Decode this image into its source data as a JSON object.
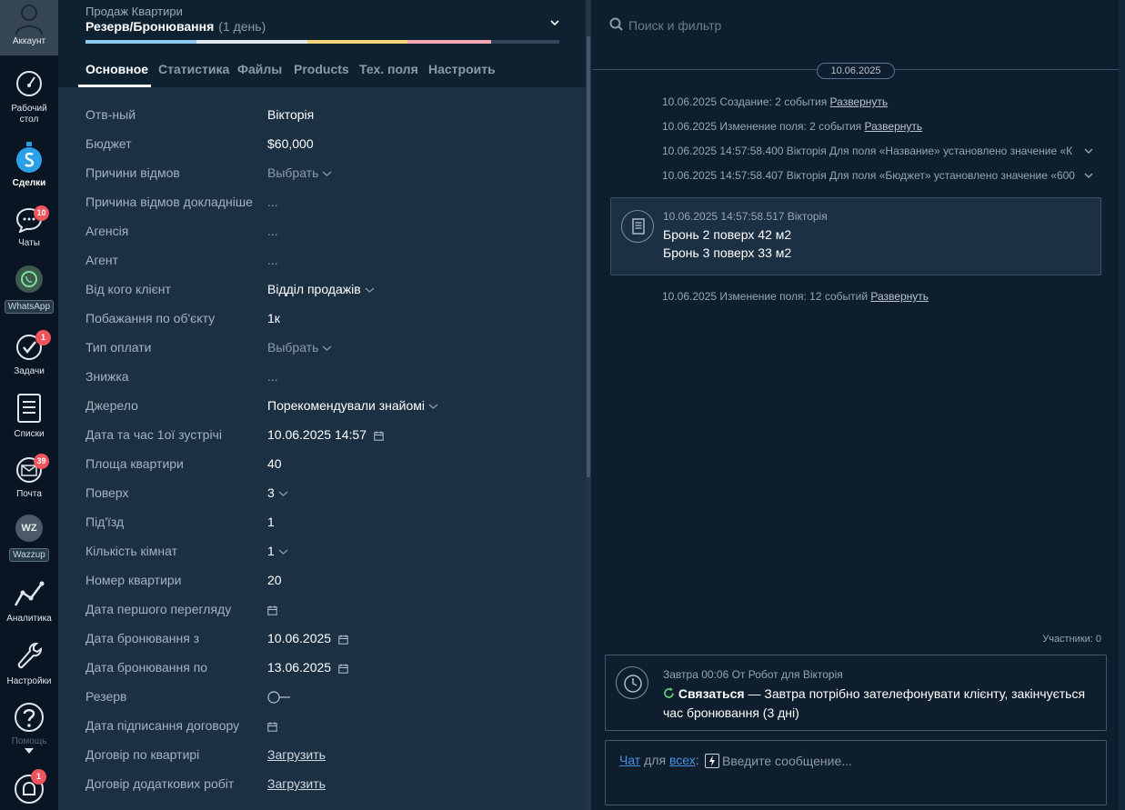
{
  "nav": {
    "account_label": "Аккаунт",
    "items": [
      {
        "label": "Рабочий стол",
        "label2": "стол"
      },
      {
        "label": "Сделки"
      },
      {
        "label": "Чаты",
        "badge": "10"
      },
      {
        "label": "WhatsApp"
      },
      {
        "label": "Задачи",
        "badge": "1"
      },
      {
        "label": "Списки"
      },
      {
        "label": "Почта",
        "badge": "39"
      },
      {
        "label": "Wazzup",
        "icon_text": "WZ"
      },
      {
        "label": "Аналитика"
      },
      {
        "label": "Настройки"
      },
      {
        "label": "Помощь"
      },
      {
        "label": "",
        "badge": "1"
      }
    ],
    "dashboard_line1": "Рабочий",
    "dashboard_line2": "стол"
  },
  "card": {
    "pipeline": "Продаж Квартири",
    "stage": "Резерв/Бронювання",
    "stage_days": "(1 день)",
    "progress_colors": [
      "#8ec9f2",
      "#f2d479",
      "#f7a7b4"
    ],
    "tabs": [
      "Основное",
      "Статистика",
      "Файлы",
      "Products",
      "Тех. поля",
      "Настроить"
    ],
    "fields": [
      {
        "label": "Отв-ный",
        "value": "Вікторія"
      },
      {
        "label": "Бюджет",
        "value": "$60,000"
      },
      {
        "label": "Причини відмов",
        "value": "Выбрать",
        "style": "muted",
        "icon": "chevron-down"
      },
      {
        "label": "Причина відмов докладніше",
        "value": "...",
        "style": "muted"
      },
      {
        "label": "Агенсія",
        "value": "...",
        "style": "muted"
      },
      {
        "label": "Агент",
        "value": "...",
        "style": "muted"
      },
      {
        "label": "Від кого клієнт",
        "value": "Відділ продажів",
        "icon": "chevron-down"
      },
      {
        "label": "Побажання по об'єкту",
        "value": "1к"
      },
      {
        "label": "Тип оплати",
        "value": "Выбрать",
        "style": "muted",
        "icon": "chevron-down"
      },
      {
        "label": "Знижка",
        "value": "...",
        "style": "muted"
      },
      {
        "label": "Джерело",
        "value": "Порекомендували знайомі",
        "icon": "chevron-down"
      },
      {
        "label": "Дата та час 1ої зустрічі",
        "value": "10.06.2025 14:57",
        "icon": "calendar"
      },
      {
        "label": "Площа квартири",
        "value": "40"
      },
      {
        "label": "Поверх",
        "value": "3",
        "icon": "chevron-down"
      },
      {
        "label": "Під'їзд",
        "value": "1"
      },
      {
        "label": "Кількість кімнат",
        "value": "1",
        "icon": "chevron-down"
      },
      {
        "label": "Номер квартири",
        "value": "20"
      },
      {
        "label": "Дата першого перегляду",
        "value": "",
        "icon": "calendar"
      },
      {
        "label": "Дата бронювання з",
        "value": "10.06.2025",
        "icon": "calendar"
      },
      {
        "label": "Дата бронювання по",
        "value": "13.06.2025",
        "icon": "calendar"
      },
      {
        "label": "Резерв",
        "value": "",
        "icon": "toggle"
      },
      {
        "label": "Дата підписання договору",
        "value": "",
        "icon": "calendar"
      },
      {
        "label": "Договір по квартирі",
        "value": "Загрузить",
        "style": "link"
      },
      {
        "label": "Договір додаткових робіт",
        "value": "Загрузить",
        "style": "link"
      }
    ]
  },
  "feed": {
    "search_placeholder": "Поиск и фильтр",
    "date": "10.06.2025",
    "events": [
      {
        "text": "10.06.2025 Создание: 2 события",
        "link": "Развернуть"
      },
      {
        "text": "10.06.2025 Изменение поля: 2 события",
        "link": "Развернуть"
      },
      {
        "text": "10.06.2025 14:57:58.400 Вікторія Для поля «Название» установлено значение «К",
        "chevron": true
      },
      {
        "text": "10.06.2025 14:57:58.407 Вікторія Для поля «Бюджет» установлено значение «600",
        "chevron": true
      }
    ],
    "note": {
      "meta": "10.06.2025 14:57:58.517 Вікторія",
      "lines": [
        "Бронь 2 поверх 42 м2",
        "Бронь 3 поверх 33 м2"
      ]
    },
    "event_after": {
      "text": "10.06.2025 Изменение поля: 12 событий",
      "link": "Развернуть"
    },
    "participants": "Участники: 0",
    "task": {
      "meta": "Завтра 00:06 От Робот для Вікторія",
      "type": "Связаться",
      "text": " — Завтра потрібно зателефонувати клієнту, закінчується час бронювання (3 дні)"
    },
    "compose": {
      "chat": "Чат",
      "for": "для",
      "all": "всех",
      "colon": ":",
      "placeholder": "Введите сообщение..."
    }
  }
}
